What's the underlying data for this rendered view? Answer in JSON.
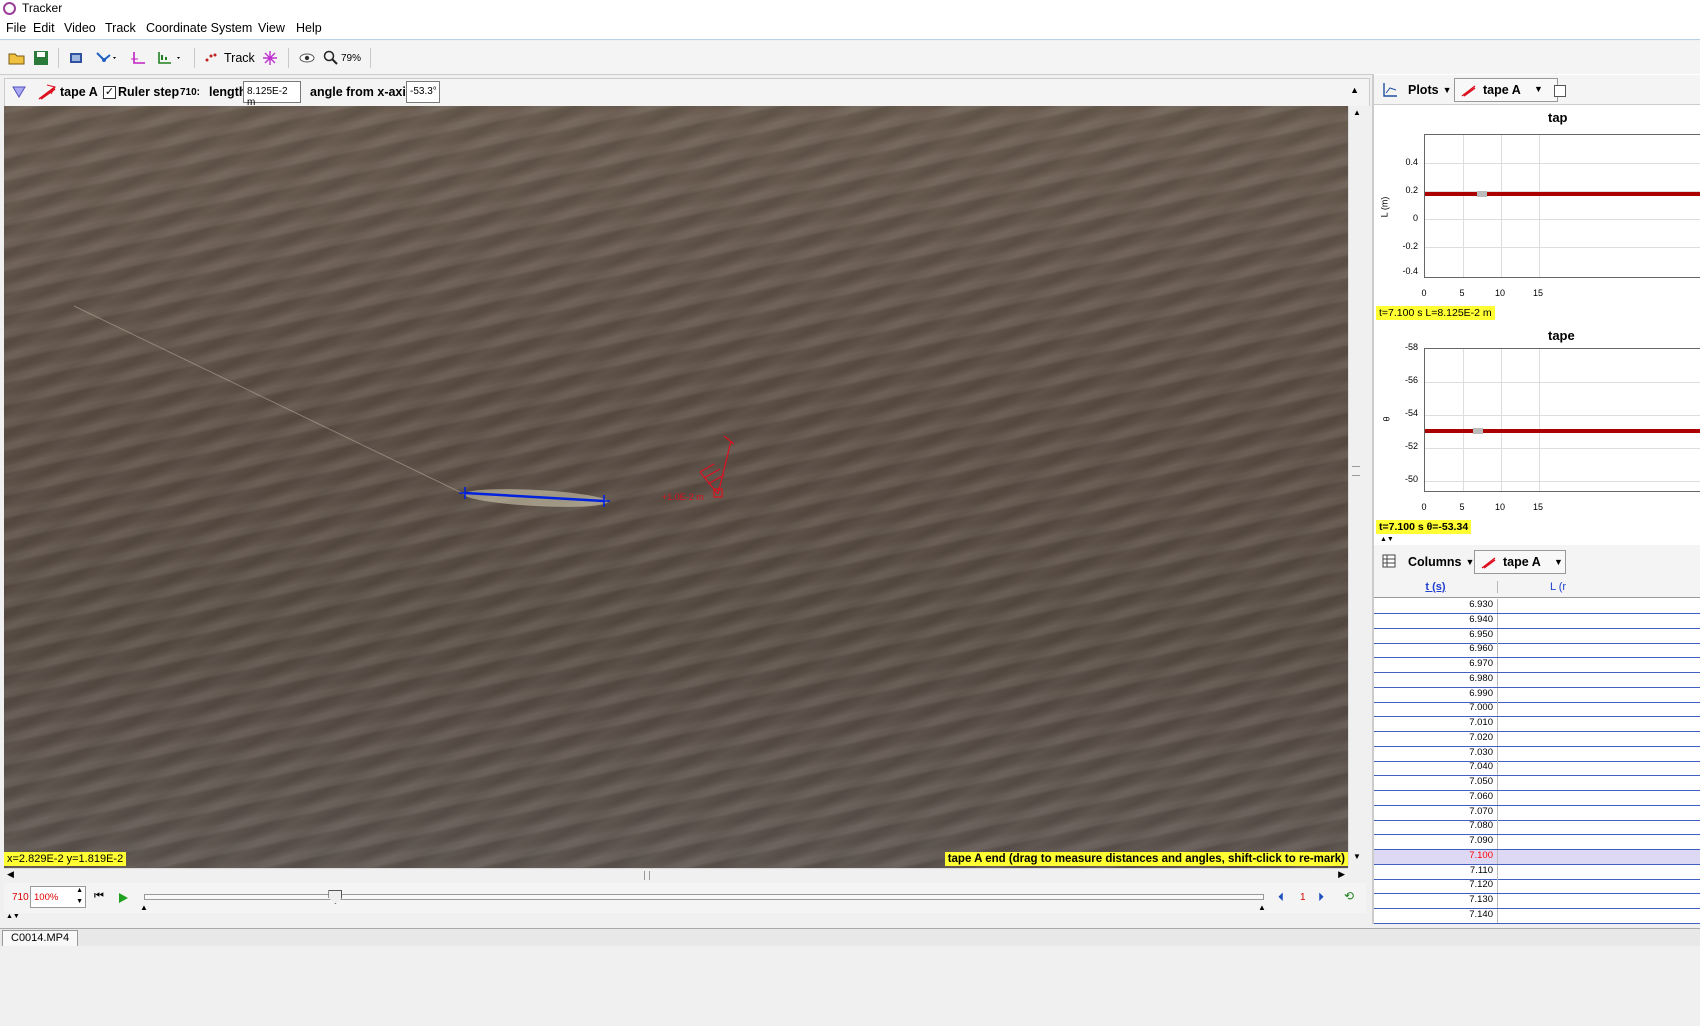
{
  "window": {
    "title": "Tracker"
  },
  "menu": {
    "file": "File",
    "edit": "Edit",
    "video": "Video",
    "track": "Track",
    "coordinate_system": "Coordinate System",
    "view": "View",
    "help": "Help"
  },
  "toolbar": {
    "track_label": "Track",
    "zoom": "79%"
  },
  "trackbar": {
    "track_name": "tape A",
    "ruler_step_label": "Ruler step",
    "ruler_checked": true,
    "frame": "710:",
    "length_label": "length",
    "length_value": "8.125E-2 m",
    "angle_label": "angle from x-axis",
    "angle_value": "-53.3°"
  },
  "video": {
    "coords": "x=2.829E-2  y=1.819E-2",
    "hint": "tape A end (drag to measure distances and angles, shift-click to re-mark)"
  },
  "player": {
    "frame": "710",
    "rate": "100%",
    "step": "1",
    "slider_fraction": 0.17
  },
  "plots_panel": {
    "plots_label": "Plots",
    "track_label": "tape A",
    "plot1": {
      "title": "tap",
      "ylabel": "L (m)",
      "yticks": [
        "0.4",
        "0.2",
        "0",
        "-0.2",
        "-0.4"
      ],
      "xticks": [
        "0",
        "5",
        "10",
        "15"
      ],
      "readout": "t=7.100 s  L=8.125E-2 m",
      "value": 0.08125
    },
    "plot2": {
      "title": "tape",
      "ylabel": "θ",
      "yticks": [
        "-58",
        "-56",
        "-54",
        "-52",
        "-50"
      ],
      "xticks": [
        "0",
        "5",
        "10",
        "15"
      ],
      "readout": "t=7.100 s  θ=-53.34",
      "value": -53.34
    }
  },
  "table_panel": {
    "columns_label": "Columns",
    "track_label": "tape A",
    "headers": [
      "t (s)",
      "L (r"
    ],
    "rows": [
      "6.930",
      "6.940",
      "6.950",
      "6.960",
      "6.970",
      "6.980",
      "6.990",
      "7.000",
      "7.010",
      "7.020",
      "7.030",
      "7.040",
      "7.050",
      "7.060",
      "7.070",
      "7.080",
      "7.090",
      "7.100",
      "7.110",
      "7.120",
      "7.130",
      "7.140"
    ],
    "selected": "7.100"
  },
  "status": {
    "tab": "C0014.MP4"
  },
  "colors": {
    "accent": "#0000ff",
    "tape": "#0022dd",
    "axes": "#dd0000",
    "highlight": "#ffff33",
    "plotline": "#aa0000"
  }
}
